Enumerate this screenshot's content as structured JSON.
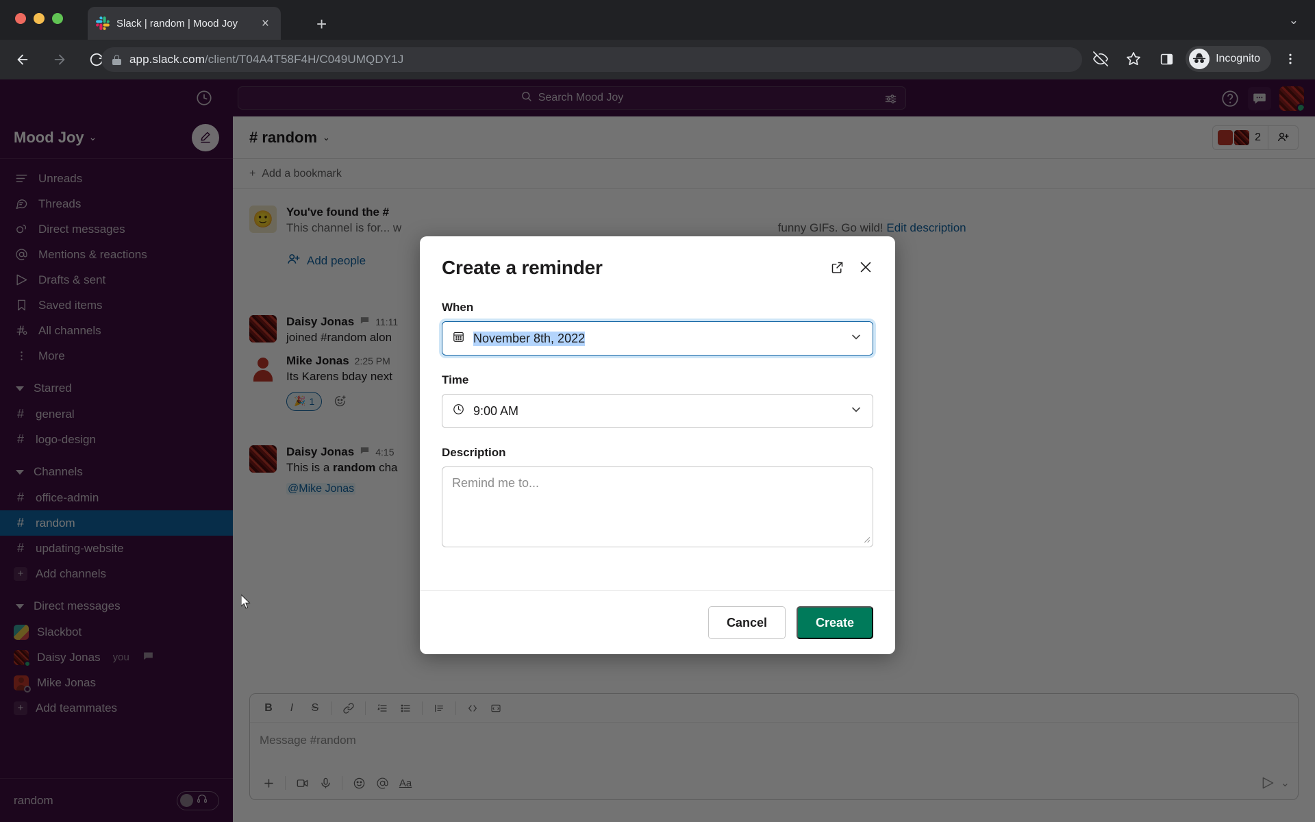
{
  "browser": {
    "tab": {
      "title": "Slack | random | Mood Joy",
      "favicon_name": "slack-favicon",
      "close_label": "×"
    },
    "new_tab_label": "+",
    "tabstrip_chevron": "⌄",
    "url_domain": "app.slack.com",
    "url_path": "/client/T04A4T58F4H/C049UMQDY1J",
    "profile_label": "Incognito",
    "icons": [
      "back-arrow",
      "forward-arrow",
      "reload",
      "lock",
      "no-tracking-eye",
      "bookmark-star",
      "side-panel",
      "incognito-avatar",
      "browser-menu-kebab"
    ]
  },
  "slack": {
    "topbar": {
      "history_icon": "clock-history-icon",
      "search_placeholder": "Search Mood Joy",
      "filter_icon": "search-filter-icon",
      "help_icon": "help-question-icon",
      "messages_icon": "chat-bubble-icon",
      "avatar_name": "user-avatar"
    },
    "sidebar": {
      "workspace_name": "Mood Joy",
      "workspace_caret": "⌄",
      "compose_label": "compose-new-message",
      "nav_items": [
        {
          "label": "Unreads",
          "icon": "unreads-lines-icon"
        },
        {
          "label": "Threads",
          "icon": "threads-bubble-icon"
        },
        {
          "label": "Direct messages",
          "icon": "direct-messages-icon"
        },
        {
          "label": "Mentions & reactions",
          "icon": "at-mention-icon"
        },
        {
          "label": "Drafts & sent",
          "icon": "drafts-paper-plane-icon"
        },
        {
          "label": "Saved items",
          "icon": "bookmark-ribbon-icon"
        },
        {
          "label": "All channels",
          "icon": "all-channels-hash-icon"
        },
        {
          "label": "More",
          "icon": "more-kebab-icon"
        }
      ],
      "starred_section": {
        "title": "Starred",
        "items": [
          {
            "label": "general"
          },
          {
            "label": "logo-design"
          }
        ]
      },
      "channels_section": {
        "title": "Channels",
        "items": [
          {
            "label": "office-admin",
            "active": false
          },
          {
            "label": "random",
            "active": true
          },
          {
            "label": "updating-website",
            "active": false
          }
        ],
        "add_label": "Add channels"
      },
      "dm_section": {
        "title": "Direct messages",
        "items": [
          {
            "label": "Slackbot",
            "you": "",
            "badge": ""
          },
          {
            "label": "Daisy Jonas",
            "you": "you",
            "badge": "thread-bubble-icon"
          },
          {
            "label": "Mike Jonas",
            "you": "",
            "badge": ""
          }
        ],
        "add_label": "Add teammates"
      },
      "footer": {
        "label": "random",
        "huddle_icon": "headphones-icon"
      }
    },
    "channel": {
      "name": "# random",
      "caret": "⌄",
      "member_count": "2",
      "add_member_icon": "add-person-icon",
      "bookmark_label": "Add a bookmark",
      "bookmark_plus": "+"
    },
    "messages": [
      {
        "avatar": "smiley-avatar",
        "author": "You've found the #",
        "time": "",
        "text": "This channel is for... w",
        "text_right": "funny GIFs. Go wild!",
        "link": "Edit description",
        "is_intro": true
      },
      {
        "avatar": "daisy-avatar",
        "author": "Daisy Jonas",
        "thread_icon": "thread-bubble-icon",
        "time": "11:11",
        "text": "joined #random alon"
      },
      {
        "avatar": "mike-avatar",
        "author": "Mike Jonas",
        "time": "2:25 PM",
        "text": "Its Karens bday next",
        "reaction_emoji": "🎉",
        "reaction_count": "1",
        "add_reaction_icon": "add-reaction-icon"
      },
      {
        "avatar": "daisy-avatar",
        "author": "Daisy Jonas",
        "thread_icon": "thread-bubble-icon",
        "time": "4:15",
        "text_pre": "This is a ",
        "text_bold": "random",
        "text_post": " cha",
        "mention": "@Mike Jonas"
      }
    ],
    "add_people_label": "Add people",
    "composer": {
      "placeholder": "Message #random",
      "format_buttons": [
        "bold",
        "italic",
        "strikethrough",
        "link",
        "ordered-list",
        "bulleted-list",
        "blockquote",
        "code",
        "code-block"
      ],
      "action_buttons": [
        "plus-attach",
        "video-clip",
        "audio-clip",
        "emoji",
        "mention",
        "formatting-Aa"
      ],
      "send_icon": "send-paper-plane-icon",
      "send_caret": "⌄"
    }
  },
  "modal": {
    "title": "Create a reminder",
    "open_external_icon": "open-in-new-icon",
    "close_icon": "close-x-icon",
    "when": {
      "label": "When",
      "value": "November 8th, 2022",
      "icon": "calendar-icon",
      "caret": "⌄",
      "selected": true
    },
    "time": {
      "label": "Time",
      "value": "9:00 AM",
      "icon": "clock-icon",
      "caret": "⌄"
    },
    "description": {
      "label": "Description",
      "placeholder": "Remind me to..."
    },
    "cancel_label": "Cancel",
    "create_label": "Create",
    "accent_color": "#007a5a",
    "focus_color": "#1264a3"
  }
}
